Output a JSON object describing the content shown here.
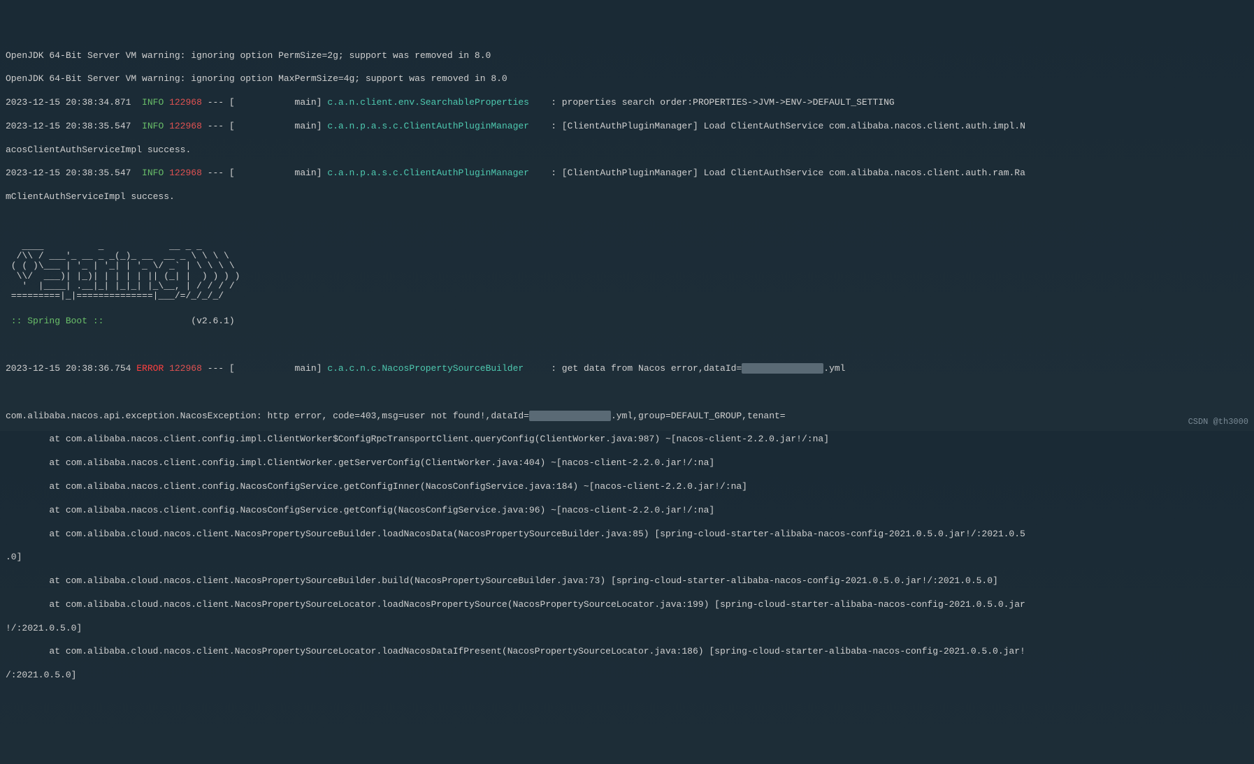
{
  "warnings": {
    "line1": "OpenJDK 64-Bit Server VM warning: ignoring option PermSize=2g; support was removed in 8.0",
    "line2": "OpenJDK 64-Bit Server VM warning: ignoring option MaxPermSize=4g; support was removed in 8.0"
  },
  "logs": [
    {
      "timestamp": "2023-12-15 20:38:34.871",
      "level": "INFO",
      "pid": "122968",
      "thread_prefix": " --- [           main] ",
      "logger": "c.a.n.client.env.SearchableProperties   ",
      "sep": " : ",
      "message": "properties search order:PROPERTIES->JVM->ENV->DEFAULT_SETTING"
    },
    {
      "timestamp": "2023-12-15 20:38:35.547",
      "level": "INFO",
      "pid": "122968",
      "thread_prefix": " --- [           main] ",
      "logger": "c.a.n.p.a.s.c.ClientAuthPluginManager   ",
      "sep": " : ",
      "message": "[ClientAuthPluginManager] Load ClientAuthService com.alibaba.nacos.client.auth.impl.N"
    }
  ],
  "continuation1": "acosClientAuthServiceImpl success.",
  "logs2": [
    {
      "timestamp": "2023-12-15 20:38:35.547",
      "level": "INFO",
      "pid": "122968",
      "thread_prefix": " --- [           main] ",
      "logger": "c.a.n.p.a.s.c.ClientAuthPluginManager   ",
      "sep": " : ",
      "message": "[ClientAuthPluginManager] Load ClientAuthService com.alibaba.nacos.client.auth.ram.Ra"
    }
  ],
  "continuation2": "mClientAuthServiceImpl success.",
  "banner": {
    "ascii": "   ____          _            __ _ _\n  /\\\\ / ___'_ __ _ _(_)_ __  __ _ \\ \\ \\ \\\n ( ( )\\___ | '_ | '_| | '_ \\/ _` | \\ \\ \\ \\\n  \\\\/  ___)| |_)| | | | | || (_| |  ) ) ) )\n   '  |____| .__|_| |_|_| |_\\__, | / / / /\n =========|_|==============|___/=/_/_/_/",
    "label_prefix": " :: ",
    "label": "Spring Boot",
    "label_suffix": " ::                ",
    "version": "(v2.6.1)"
  },
  "error_log": {
    "timestamp": "2023-12-15 20:38:36.754",
    "level": "ERROR",
    "pid": "122968",
    "thread_prefix": " --- [           main] ",
    "logger": "c.a.c.n.c.NacosPropertySourceBuilder    ",
    "sep": " : ",
    "message_pre": "get data from Nacos error,dataId=",
    "redacted": "xxxxxxxxxxxxxxx",
    "message_post": ".yml"
  },
  "exception": {
    "line1_pre": "com.alibaba.nacos.api.exception.NacosException: http error, code=403,msg=user not found!,dataId=",
    "redacted": "xxxxxxxxxxxxxxx",
    "line1_post": ".yml,group=DEFAULT_GROUP,tenant=",
    "stack": [
      "        at com.alibaba.nacos.client.config.impl.ClientWorker$ConfigRpcTransportClient.queryConfig(ClientWorker.java:987) ~[nacos-client-2.2.0.jar!/:na]",
      "        at com.alibaba.nacos.client.config.impl.ClientWorker.getServerConfig(ClientWorker.java:404) ~[nacos-client-2.2.0.jar!/:na]",
      "        at com.alibaba.nacos.client.config.NacosConfigService.getConfigInner(NacosConfigService.java:184) ~[nacos-client-2.2.0.jar!/:na]",
      "        at com.alibaba.nacos.client.config.NacosConfigService.getConfig(NacosConfigService.java:96) ~[nacos-client-2.2.0.jar!/:na]",
      "        at com.alibaba.cloud.nacos.client.NacosPropertySourceBuilder.loadNacosData(NacosPropertySourceBuilder.java:85) [spring-cloud-starter-alibaba-nacos-config-2021.0.5.0.jar!/:2021.0.5",
      ".0]",
      "        at com.alibaba.cloud.nacos.client.NacosPropertySourceBuilder.build(NacosPropertySourceBuilder.java:73) [spring-cloud-starter-alibaba-nacos-config-2021.0.5.0.jar!/:2021.0.5.0]",
      "        at com.alibaba.cloud.nacos.client.NacosPropertySourceLocator.loadNacosPropertySource(NacosPropertySourceLocator.java:199) [spring-cloud-starter-alibaba-nacos-config-2021.0.5.0.jar",
      "!/:2021.0.5.0]",
      "        at com.alibaba.cloud.nacos.client.NacosPropertySourceLocator.loadNacosDataIfPresent(NacosPropertySourceLocator.java:186) [spring-cloud-starter-alibaba-nacos-config-2021.0.5.0.jar!",
      "/:2021.0.5.0]"
    ]
  },
  "watermark": "CSDN @th3000"
}
